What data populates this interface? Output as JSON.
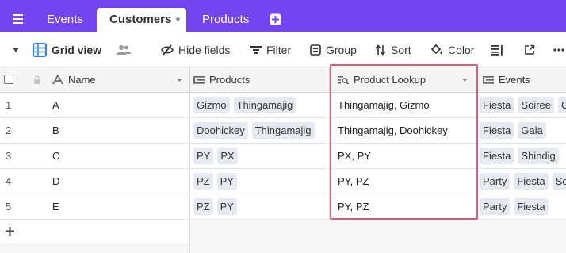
{
  "tabs": {
    "events": "Events",
    "customers": "Customers",
    "products": "Products"
  },
  "toolbar": {
    "view_name": "Grid view",
    "hide_fields": "Hide fields",
    "filter": "Filter",
    "group": "Group",
    "sort": "Sort",
    "color": "Color"
  },
  "columns": {
    "name": "Name",
    "products": "Products",
    "lookup": "Product Lookup",
    "events": "Events"
  },
  "rows": [
    {
      "num": "1",
      "name": "A",
      "products": [
        "Gizmo",
        "Thingamajig"
      ],
      "lookup": "Thingamajig, Gizmo",
      "events": [
        "Fiesta",
        "Soiree",
        "Gala"
      ]
    },
    {
      "num": "2",
      "name": "B",
      "products": [
        "Doohickey",
        "Thingamajig"
      ],
      "lookup": "Thingamajig, Doohickey",
      "events": [
        "Fiesta",
        "Gala"
      ]
    },
    {
      "num": "3",
      "name": "C",
      "products": [
        "PY",
        "PX"
      ],
      "lookup": "PX, PY",
      "events": [
        "Fiesta",
        "Shindig"
      ]
    },
    {
      "num": "4",
      "name": "D",
      "products": [
        "PZ",
        "PY"
      ],
      "lookup": "PY, PZ",
      "events": [
        "Party",
        "Fiesta",
        "Soiree"
      ]
    },
    {
      "num": "5",
      "name": "E",
      "products": [
        "PZ",
        "PY"
      ],
      "lookup": "PY, PZ",
      "events": [
        "Party",
        "Fiesta"
      ]
    }
  ],
  "colors": {
    "tabbar": "#7444f0",
    "highlight": "#e05a7f",
    "pill": "#e6eaf0",
    "grid_icon": "#2d7ff9"
  },
  "icons": {
    "menu": "hamburger-icon",
    "add_tab": "add-table-icon",
    "grid": "grid-view-icon",
    "collaborators": "people-icon",
    "hide_fields": "hide-fields-icon",
    "filter": "filter-icon",
    "group": "group-icon",
    "sort": "sort-icon",
    "color": "paint-bucket-icon",
    "row_height": "row-height-icon",
    "share": "share-icon",
    "more": "more-icon"
  }
}
